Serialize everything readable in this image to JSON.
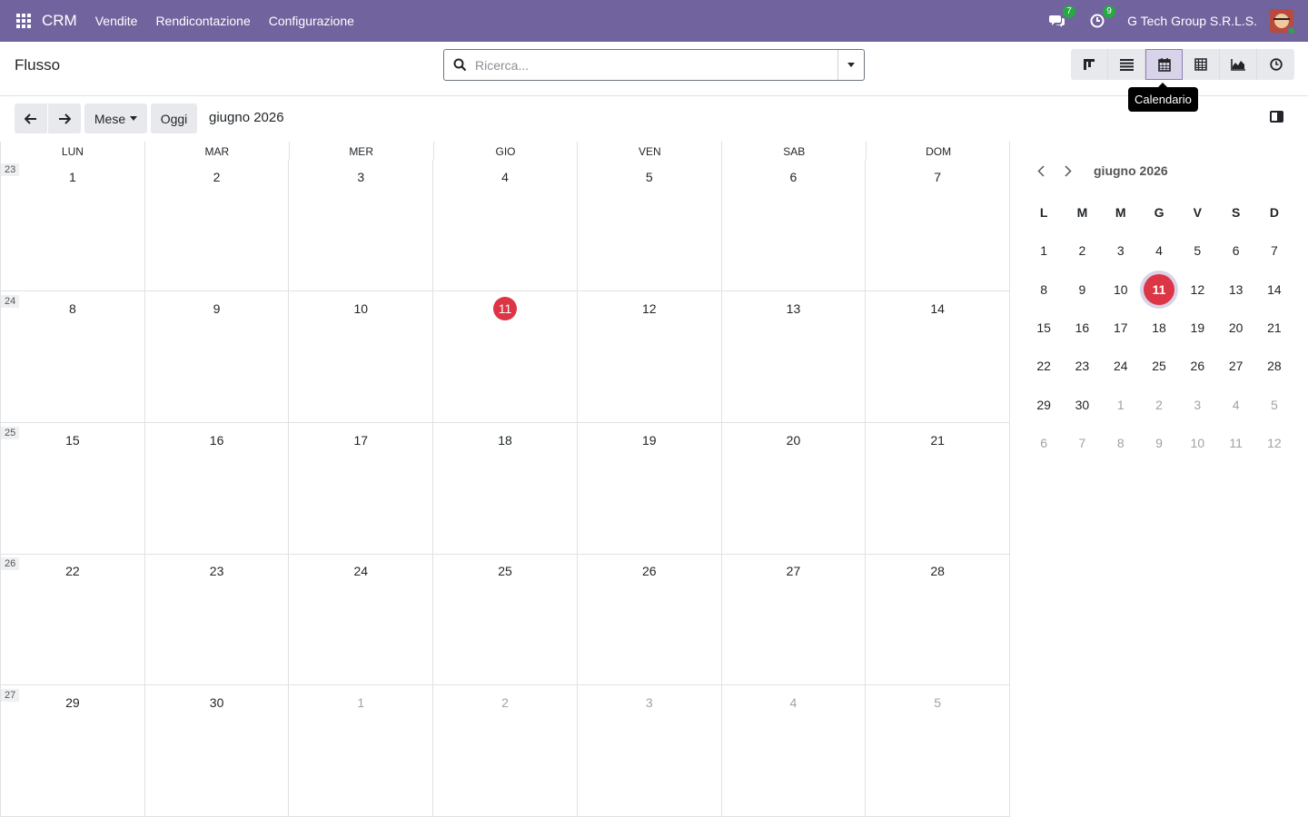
{
  "navbar": {
    "app_name": "CRM",
    "menu": [
      "Vendite",
      "Rendicontazione",
      "Configurazione"
    ],
    "messages_badge": "7",
    "activities_badge": "9",
    "company": "G Tech Group S.R.L.S.",
    "icons": [
      "apps-grid-icon",
      "chat-icon",
      "clock-icon",
      "user-avatar"
    ]
  },
  "control_panel": {
    "breadcrumb": "Flusso",
    "search_placeholder": "Ricerca...",
    "views": [
      {
        "name": "kanban",
        "icon": "kanban-icon",
        "active": false
      },
      {
        "name": "list",
        "icon": "list-icon",
        "active": false
      },
      {
        "name": "calendar",
        "icon": "calendar-icon",
        "active": true
      },
      {
        "name": "pivot",
        "icon": "pivot-icon",
        "active": false
      },
      {
        "name": "graph",
        "icon": "area-chart-icon",
        "active": false
      },
      {
        "name": "activity",
        "icon": "clock-icon",
        "active": false
      }
    ],
    "tooltip": "Calendario"
  },
  "toolbar": {
    "scale_label": "Mese",
    "today_label": "Oggi",
    "range_title": "giugno 2026"
  },
  "month": {
    "weekdays": [
      "LUN",
      "MAR",
      "MER",
      "GIO",
      "VEN",
      "SAB",
      "DOM"
    ],
    "weeks": [
      {
        "weeknum": "23",
        "days": [
          "1",
          "2",
          "3",
          "4",
          "5",
          "6",
          "7"
        ]
      },
      {
        "weeknum": "24",
        "days": [
          "8",
          "9",
          "10",
          "11",
          "12",
          "13",
          "14"
        ]
      },
      {
        "weeknum": "25",
        "days": [
          "15",
          "16",
          "17",
          "18",
          "19",
          "20",
          "21"
        ]
      },
      {
        "weeknum": "26",
        "days": [
          "22",
          "23",
          "24",
          "25",
          "26",
          "27",
          "28"
        ]
      },
      {
        "weeknum": "27",
        "days": [
          "29",
          "30",
          "1",
          "2",
          "3",
          "4",
          "5"
        ]
      }
    ],
    "today": "11"
  },
  "mini": {
    "title": "giugno 2026",
    "weekdays": [
      "L",
      "M",
      "M",
      "G",
      "V",
      "S",
      "D"
    ],
    "rows": [
      [
        "1",
        "2",
        "3",
        "4",
        "5",
        "6",
        "7"
      ],
      [
        "8",
        "9",
        "10",
        "11",
        "12",
        "13",
        "14"
      ],
      [
        "15",
        "16",
        "17",
        "18",
        "19",
        "20",
        "21"
      ],
      [
        "22",
        "23",
        "24",
        "25",
        "26",
        "27",
        "28"
      ],
      [
        "29",
        "30",
        "1",
        "2",
        "3",
        "4",
        "5"
      ],
      [
        "6",
        "7",
        "8",
        "9",
        "10",
        "11",
        "12"
      ]
    ]
  },
  "colors": {
    "navbar": "#71639e",
    "today": "#dc3545",
    "badge": "#28a745"
  }
}
